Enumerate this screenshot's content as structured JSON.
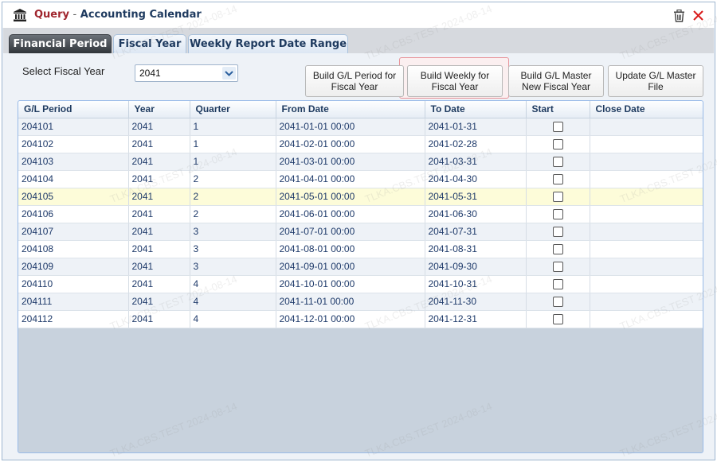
{
  "window": {
    "title_prefix": "Query",
    "title_sep": "-",
    "title": "Accounting Calendar",
    "watermark": "TLKA.CBS.TEST 2024-08-14"
  },
  "tabs": [
    {
      "label": "Financial Period",
      "active": true
    },
    {
      "label": "Fiscal Year",
      "active": false
    },
    {
      "label": "Weekly Report Date Range",
      "active": false
    }
  ],
  "filter": {
    "label": "Select Fiscal Year",
    "value": "2041"
  },
  "buttons": [
    {
      "line1": "Build G/L Period for",
      "line2": "Fiscal Year"
    },
    {
      "line1": "Build Weekly for",
      "line2": "Fiscal Year"
    },
    {
      "line1": "Build G/L Master",
      "line2": "New Fiscal Year"
    },
    {
      "line1": "Update G/L Master",
      "line2": "File"
    }
  ],
  "grid": {
    "columns": [
      "G/L Period",
      "Year",
      "Quarter",
      "From Date",
      "To Date",
      "Start",
      "Close Date"
    ],
    "selected_row": 4,
    "rows": [
      {
        "period": "204101",
        "year": "2041",
        "quarter": "1",
        "from": "2041-01-01 00:00",
        "to": "2041-01-31",
        "start": false,
        "close": ""
      },
      {
        "period": "204102",
        "year": "2041",
        "quarter": "1",
        "from": "2041-02-01 00:00",
        "to": "2041-02-28",
        "start": false,
        "close": ""
      },
      {
        "period": "204103",
        "year": "2041",
        "quarter": "1",
        "from": "2041-03-01 00:00",
        "to": "2041-03-31",
        "start": false,
        "close": ""
      },
      {
        "period": "204104",
        "year": "2041",
        "quarter": "2",
        "from": "2041-04-01 00:00",
        "to": "2041-04-30",
        "start": false,
        "close": ""
      },
      {
        "period": "204105",
        "year": "2041",
        "quarter": "2",
        "from": "2041-05-01 00:00",
        "to": "2041-05-31",
        "start": false,
        "close": ""
      },
      {
        "period": "204106",
        "year": "2041",
        "quarter": "2",
        "from": "2041-06-01 00:00",
        "to": "2041-06-30",
        "start": false,
        "close": ""
      },
      {
        "period": "204107",
        "year": "2041",
        "quarter": "3",
        "from": "2041-07-01 00:00",
        "to": "2041-07-31",
        "start": false,
        "close": ""
      },
      {
        "period": "204108",
        "year": "2041",
        "quarter": "3",
        "from": "2041-08-01 00:00",
        "to": "2041-08-31",
        "start": false,
        "close": ""
      },
      {
        "period": "204109",
        "year": "2041",
        "quarter": "3",
        "from": "2041-09-01 00:00",
        "to": "2041-09-30",
        "start": false,
        "close": ""
      },
      {
        "period": "204110",
        "year": "2041",
        "quarter": "4",
        "from": "2041-10-01 00:00",
        "to": "2041-10-31",
        "start": false,
        "close": ""
      },
      {
        "period": "204111",
        "year": "2041",
        "quarter": "4",
        "from": "2041-11-01 00:00",
        "to": "2041-11-30",
        "start": false,
        "close": ""
      },
      {
        "period": "204112",
        "year": "2041",
        "quarter": "4",
        "from": "2041-12-01 00:00",
        "to": "2041-12-31",
        "start": false,
        "close": ""
      }
    ]
  },
  "colors": {
    "accent": "#1e3a5f",
    "title_prefix": "#a0262e",
    "selected_row": "#fdfcd9",
    "highlight": "#e8949a"
  }
}
